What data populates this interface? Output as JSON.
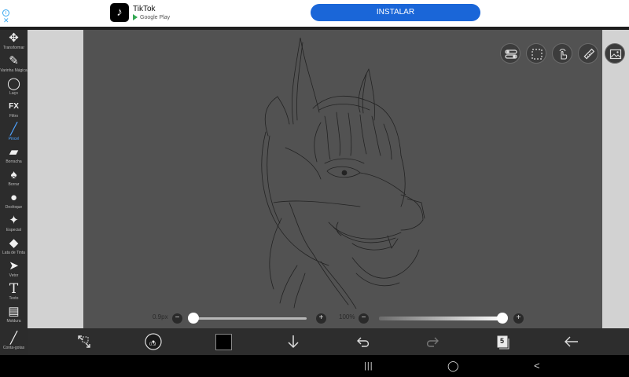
{
  "ad": {
    "app_name": "TikTok",
    "store_label": "Google Play",
    "install_label": "INSTALAR",
    "adchoices_icon": "info-icon",
    "close_icon": "close-icon"
  },
  "tools": [
    {
      "id": "transform",
      "icon": "move-arrows-icon",
      "label": "Transformar"
    },
    {
      "id": "magic-wand",
      "icon": "magic-wand-icon",
      "label": "Varinha Mágica"
    },
    {
      "id": "lasso",
      "icon": "lasso-icon",
      "label": "Laço"
    },
    {
      "id": "filter",
      "icon": "fx-icon",
      "label": "Filtro"
    },
    {
      "id": "brush",
      "icon": "brush-icon",
      "label": "Pincel",
      "active": true
    },
    {
      "id": "eraser",
      "icon": "eraser-icon",
      "label": "Borracha"
    },
    {
      "id": "smudge",
      "icon": "smudge-icon",
      "label": "Borrar"
    },
    {
      "id": "blur",
      "icon": "drop-icon",
      "label": "Desfoque"
    },
    {
      "id": "special",
      "icon": "special-wand-icon",
      "label": "Especial"
    },
    {
      "id": "bucket",
      "icon": "paint-bucket-icon",
      "label": "Lata de Tinta"
    },
    {
      "id": "vector",
      "icon": "pointer-icon",
      "label": "Vetor"
    },
    {
      "id": "text",
      "icon": "text-icon",
      "label": "Texto"
    },
    {
      "id": "frame",
      "icon": "frame-divider-icon",
      "label": "Moldura"
    },
    {
      "id": "eyedropper",
      "icon": "eyedropper-icon",
      "label": "Conta-gotas"
    }
  ],
  "glyphs": {
    "transform": "✥",
    "magic-wand": "✎",
    "lasso": "◯",
    "filter": "FX",
    "brush": "╱",
    "eraser": "▰",
    "smudge": "♠",
    "blur": "●",
    "special": "✦",
    "bucket": "◆",
    "vector": "➤",
    "text": "T",
    "frame": "▤",
    "eyedropper": "╱"
  },
  "quick_buttons": [
    "toggle-icon",
    "selection-icon",
    "hand-touch-icon",
    "ruler-icon",
    "gallery-icon"
  ],
  "brush_size": {
    "label": "0.9px",
    "value_fraction": 0.0
  },
  "opacity": {
    "label": "100%",
    "value": 100
  },
  "bottom_bar": [
    "transform-icon",
    "brush-preview-icon",
    "color-swatch",
    "download-arrow-icon",
    "undo-icon",
    "redo-icon",
    "layers-icon",
    "back-arrow-icon"
  ],
  "layers_count": "5",
  "brush_preview_label": "0.9",
  "colors": {
    "primary": "#000000",
    "accent": "#4fa3ff",
    "install": "#1a66d8"
  },
  "nav": {
    "recent": "|||",
    "home": "◯",
    "back": "<"
  }
}
